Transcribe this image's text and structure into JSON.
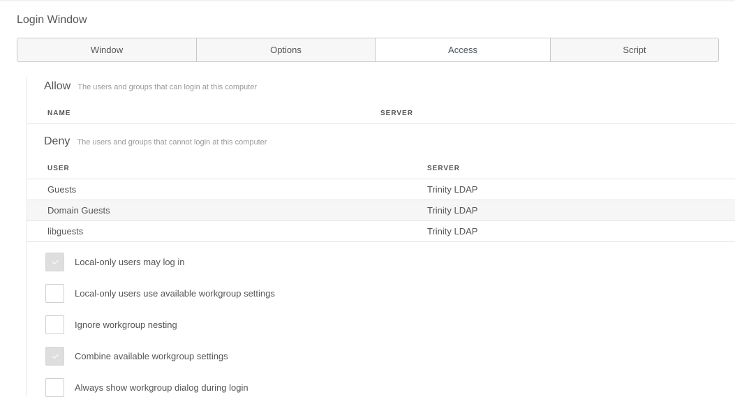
{
  "page": {
    "title": "Login Window"
  },
  "tabs": [
    {
      "label": "Window",
      "active": false
    },
    {
      "label": "Options",
      "active": false
    },
    {
      "label": "Access",
      "active": true
    },
    {
      "label": "Script",
      "active": false
    }
  ],
  "allow": {
    "title": "Allow",
    "description": "The users and groups that can login at this computer",
    "columns": [
      "NAME",
      "SERVER"
    ]
  },
  "deny": {
    "title": "Deny",
    "description": "The users and groups that cannot login at this computer",
    "columns": [
      "USER",
      "SERVER"
    ],
    "rows": [
      {
        "user": "Guests",
        "server": "Trinity LDAP"
      },
      {
        "user": "Domain Guests",
        "server": "Trinity LDAP"
      },
      {
        "user": "libguests",
        "server": "Trinity LDAP"
      }
    ]
  },
  "options": [
    {
      "label": "Local-only users may log in",
      "checked": true
    },
    {
      "label": "Local-only users use available workgroup settings",
      "checked": false
    },
    {
      "label": "Ignore workgroup nesting",
      "checked": false
    },
    {
      "label": "Combine available workgroup settings",
      "checked": true
    },
    {
      "label": "Always show workgroup dialog during login",
      "checked": false
    }
  ]
}
